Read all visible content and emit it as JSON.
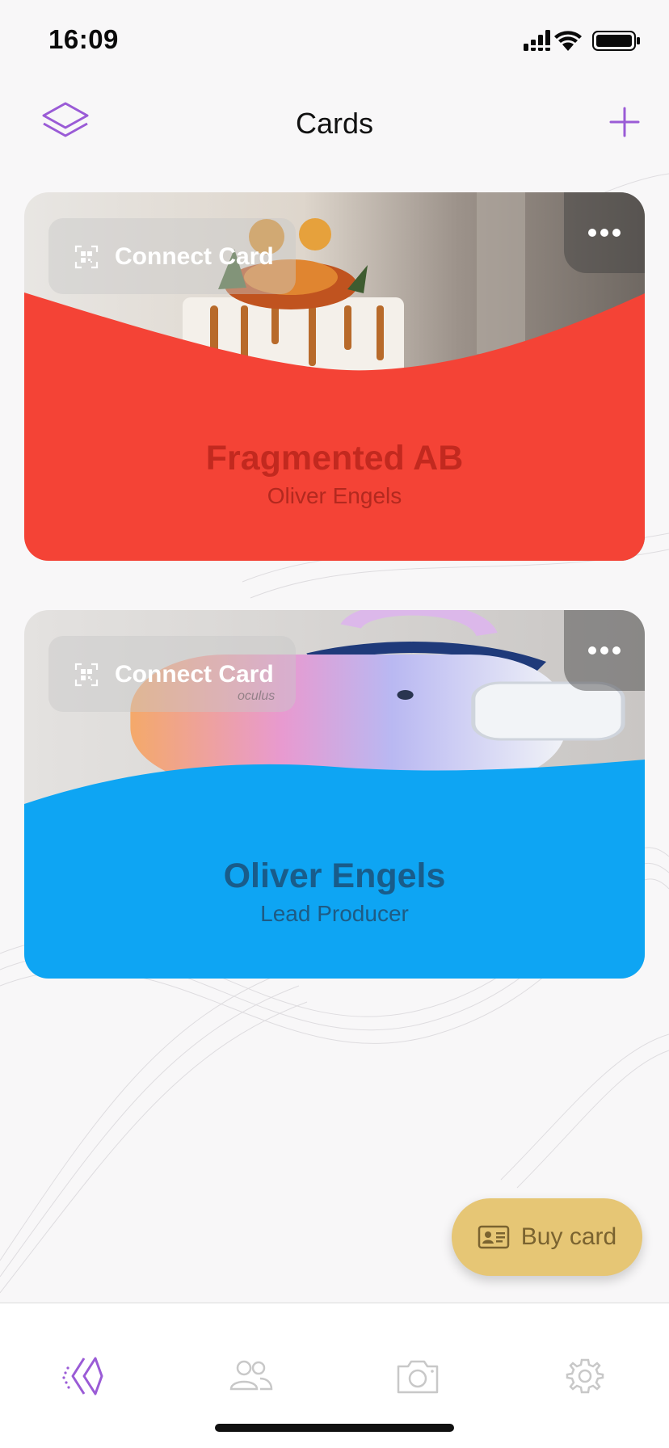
{
  "status_bar": {
    "time": "16:09"
  },
  "nav": {
    "title": "Cards"
  },
  "cards": [
    {
      "title": "Fragmented AB",
      "subtitle": "Oliver Engels",
      "connect_label": "Connect Card",
      "wave_color": "#f44336",
      "photo": "cake-photo"
    },
    {
      "title": "Oliver Engels",
      "subtitle": "Lead Producer",
      "connect_label": "Connect Card",
      "wave_color": "#0ea5f3",
      "photo": "vr-headset-photo",
      "photo_watermark": "oculus"
    }
  ],
  "buy_button": {
    "label": "Buy card"
  },
  "tabs": [
    {
      "name": "cards",
      "icon": "cards-logo-icon",
      "active": true
    },
    {
      "name": "contacts",
      "icon": "people-icon",
      "active": false
    },
    {
      "name": "scan",
      "icon": "camera-icon",
      "active": false
    },
    {
      "name": "settings",
      "icon": "gear-icon",
      "active": false
    }
  ],
  "colors": {
    "accent": "#9a5bd6",
    "card_1": "#f44336",
    "card_2": "#0ea5f3",
    "buy_button": "#e6c675",
    "inactive_icon": "#c8c8c8"
  }
}
